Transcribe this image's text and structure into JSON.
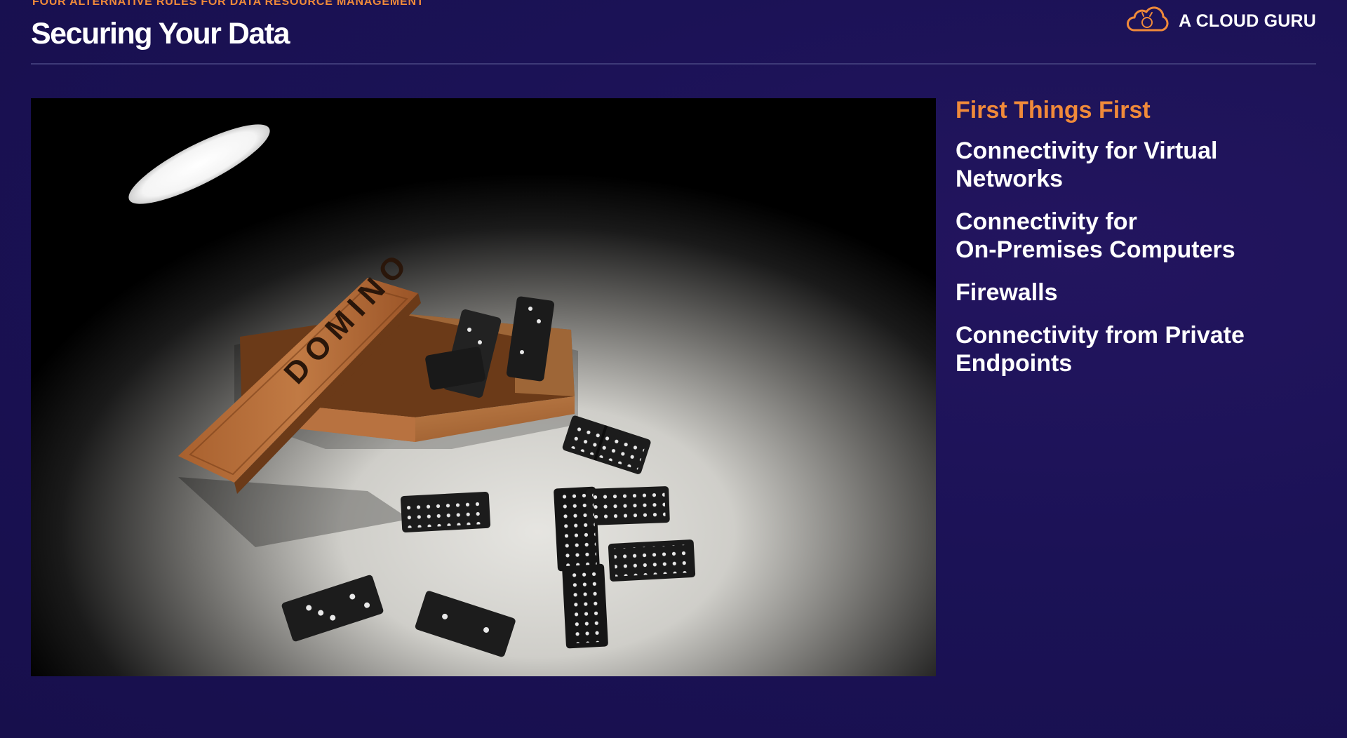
{
  "header": {
    "kicker": "FOUR ALTERNATIVE RULES FOR DATA RESOURCE MANAGEMENT",
    "title": "Securing Your Data",
    "brand": "A CLOUD GURU"
  },
  "photo": {
    "box_label": "DOMINO"
  },
  "topics": [
    {
      "lines": [
        "First Things First"
      ],
      "active": true
    },
    {
      "lines": [
        "Connectivity for Virtual",
        "Networks"
      ],
      "active": false
    },
    {
      "lines": [
        "Connectivity for",
        "On-Premises Computers"
      ],
      "active": false
    },
    {
      "lines": [
        "Firewalls"
      ],
      "active": false
    },
    {
      "lines": [
        "Connectivity from Private",
        "Endpoints"
      ],
      "active": false
    }
  ],
  "colors": {
    "background": "#1b1256",
    "accent": "#f08a3a",
    "text": "#ffffff",
    "divider": "#3e3a78"
  }
}
